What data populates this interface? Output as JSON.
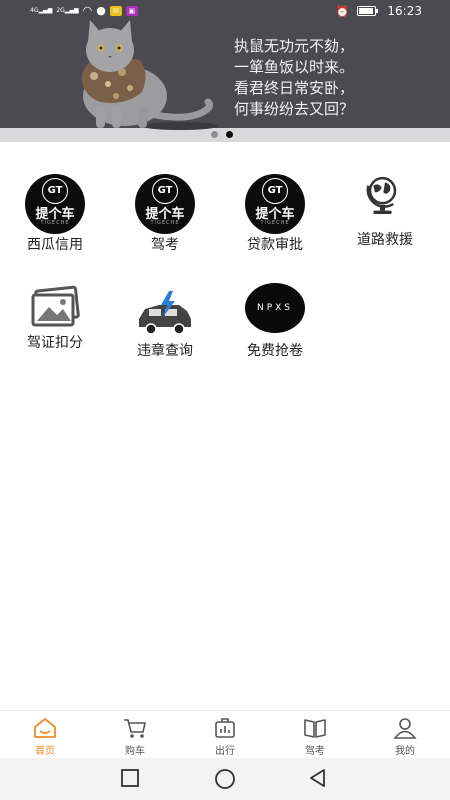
{
  "status_bar": {
    "time": "16:23",
    "signal_1_label": "4G",
    "signal_2_label": "2G"
  },
  "banner": {
    "poem_lines": [
      "执鼠无功元不劾，",
      "一箪鱼饭以时来。",
      "看君终日常安卧，",
      "何事纷纷去又回？"
    ],
    "page_index": 2,
    "page_count": 2
  },
  "shortcuts": [
    {
      "label": "西瓜信用",
      "icon": "gt-logo"
    },
    {
      "label": "驾考",
      "icon": "gt-logo"
    },
    {
      "label": "贷款审批",
      "icon": "gt-logo"
    },
    {
      "label": "道路救援",
      "icon": "globe-icon"
    },
    {
      "label": "驾证扣分",
      "icon": "photo-icon"
    },
    {
      "label": "违章查询",
      "icon": "car-lightning-icon"
    },
    {
      "label": "免费抢卷",
      "icon": "npxs-logo"
    }
  ],
  "logos": {
    "gt_ring": "GT",
    "gt_text": "提个车",
    "gt_sub": "TIGECHE",
    "npxs": "NPXS"
  },
  "tabbar": {
    "items": [
      {
        "label": "首页",
        "icon": "home-icon",
        "active": true
      },
      {
        "label": "购车",
        "icon": "cart-icon",
        "active": false
      },
      {
        "label": "出行",
        "icon": "luggage-icon",
        "active": false
      },
      {
        "label": "驾考",
        "icon": "book-icon",
        "active": false
      },
      {
        "label": "我的",
        "icon": "person-icon",
        "active": false
      }
    ]
  },
  "colors": {
    "accent": "#f08a24",
    "banner_bg": "#4a4a50",
    "tab_inactive": "#555555"
  }
}
